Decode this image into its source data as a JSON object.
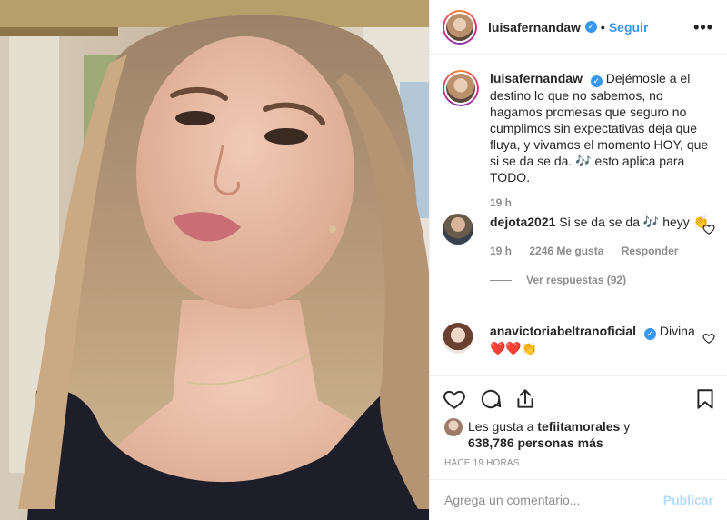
{
  "post": {
    "username": "luisafernandaw",
    "follow_label": "Seguir",
    "more_icon": "more-options-icon"
  },
  "caption": {
    "username": "luisafernandaw",
    "text": "Dejémosle a el destino lo que no sabemos, no hagamos promesas que seguro no cumplimos sin expectativas deja que fluya, y vivamos el momento HOY, que si se da se da. 🎶 esto aplica para TODO.",
    "time": "19 h"
  },
  "comments": [
    {
      "username": "dejota2021",
      "text": "Si se da se da 🎶 heyy 👏",
      "time": "19 h",
      "likes": "2246 Me gusta",
      "reply_label": "Responder",
      "view_replies": "Ver respuestas (92)"
    },
    {
      "username": "anavictoriabeltranoficial",
      "text": "Divina ❤️❤️👏"
    }
  ],
  "actions": {
    "like_icon": "heart-icon",
    "comment_icon": "comment-icon",
    "share_icon": "share-icon",
    "save_icon": "bookmark-icon"
  },
  "likes": {
    "prefix": "Les gusta a ",
    "user": "tefiitamorales",
    "middle": " y ",
    "count": "638,786 personas más"
  },
  "time_ago": "HACE 19 HORAS",
  "add_comment": {
    "placeholder": "Agrega un comentario...",
    "publish_label": "Publicar"
  },
  "colors": {
    "accent": "#3897f0",
    "publish_disabled": "#b3dbff",
    "muted": "#8e8e8e"
  }
}
